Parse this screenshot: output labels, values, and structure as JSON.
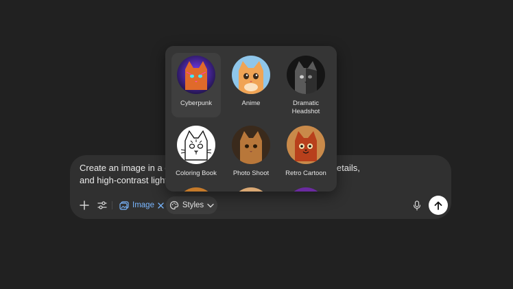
{
  "composer": {
    "prompt_line1": "Create an image in a cyb",
    "prompt_line1_end": "textures, glowing details,",
    "prompt_line2": "and high-contrast lightin",
    "image_pill_label": "Image",
    "styles_label": "Styles"
  },
  "styles_popup": {
    "items": [
      {
        "label": "Cyberpunk",
        "selected": true
      },
      {
        "label": "Anime",
        "selected": false
      },
      {
        "label": "Dramatic Headshot",
        "selected": false
      },
      {
        "label": "Coloring Book",
        "selected": false
      },
      {
        "label": "Photo Shoot",
        "selected": false
      },
      {
        "label": "Retro Cartoon",
        "selected": false
      }
    ]
  },
  "icons": {
    "add": "plus-icon",
    "tools": "sliders-icon",
    "image": "image-icon",
    "remove": "close-icon",
    "styles": "palette-icon",
    "chevron": "chevron-down-icon",
    "voice": "microphone-icon",
    "send": "arrow-up-icon"
  },
  "colors": {
    "background": "#212121",
    "composer": "#303030",
    "popup": "#353535",
    "accent": "#7ab7ff"
  }
}
